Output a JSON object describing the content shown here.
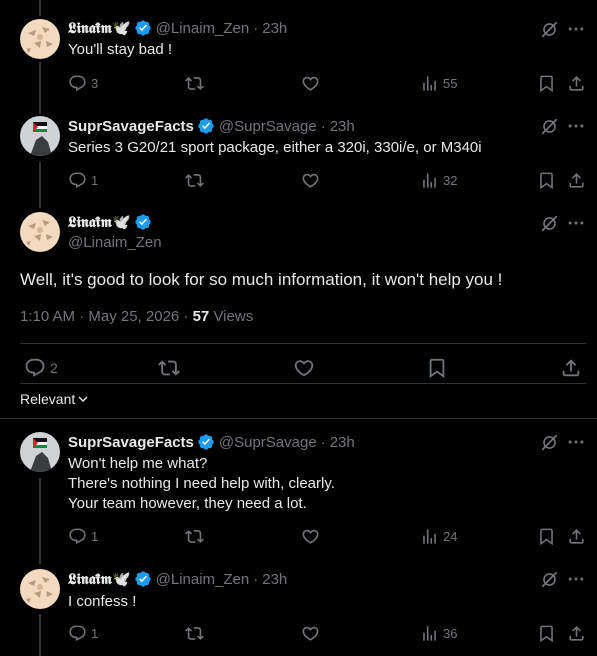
{
  "replies_top": [
    {
      "display_name": "𝕷𝖎𝖓𝖆𝖎̈𝖒🕊️",
      "handle": "@Linaim_Zen",
      "time": "23h",
      "text": "You'll stay bad !",
      "reply_count": "3",
      "retweet_count": "",
      "like_count": "",
      "views": "55"
    },
    {
      "display_name": "SuprSavageFacts",
      "handle": "@SuprSavage",
      "time": "23h",
      "text": "Series 3 G20/21 sport package, either a 320i, 330i/e, or M340i",
      "reply_count": "1",
      "retweet_count": "",
      "like_count": "",
      "views": "32"
    }
  ],
  "focus": {
    "display_name": "𝕷𝖎𝖓𝖆𝖎̈𝖒🕊️",
    "handle": "@Linaim_Zen",
    "text": "Well, it's good to look for so much information, it won't help you !",
    "timestamp": "1:10 AM · May 25, 2026 · ",
    "views_count": "57",
    "views_label": " Views",
    "reply_count": "2"
  },
  "sort_label": "Relevant",
  "replies_bottom": [
    {
      "display_name": "SuprSavageFacts",
      "handle": "@SuprSavage",
      "time": "23h",
      "text": "Won't help me what?\nThere's nothing I need help with, clearly.\nYour team however, they need a lot.",
      "reply_count": "1",
      "views": "24"
    },
    {
      "display_name": "𝕷𝖎𝖓𝖆𝖎̈𝖒🕊️",
      "handle": "@Linaim_Zen",
      "time": "23h",
      "text": "I confess !",
      "reply_count": "1",
      "views": "36"
    }
  ],
  "colors": {
    "background": "#000000",
    "text": "#e7e9ea",
    "muted": "#71767b",
    "verified": "#1d9bf0",
    "divider": "#2f3336"
  },
  "icons": [
    "reply-icon",
    "retweet-icon",
    "like-icon",
    "views-icon",
    "bookmark-icon",
    "share-icon",
    "grok-icon",
    "more-icon",
    "verified-badge-icon",
    "chevron-down-icon"
  ]
}
